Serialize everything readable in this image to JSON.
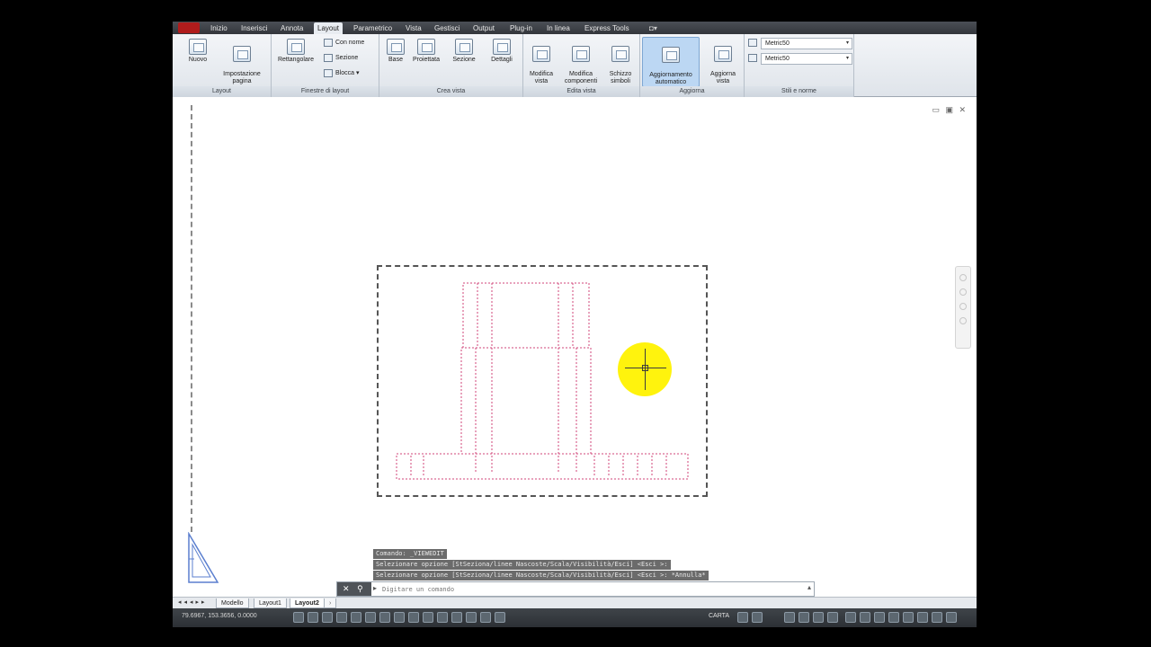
{
  "ribbon": {
    "tabs": [
      "Inizio",
      "Inserisci",
      "Annota",
      "Layout",
      "Parametrico",
      "Vista",
      "Gestisci",
      "Output",
      "Plug-in",
      "In linea",
      "Express Tools"
    ],
    "active_tab": "Layout",
    "panels": {
      "layout": {
        "title": "Layout",
        "buttons": [
          {
            "label": "Nuovo"
          },
          {
            "label": "Impostazione\npagina"
          }
        ]
      },
      "finestre": {
        "title": "Finestre di layout",
        "main_label": "Rettangolare",
        "small": [
          "Con nome",
          "Sezione",
          "Blocca"
        ]
      },
      "crea_vista": {
        "title": "Crea vista",
        "buttons": [
          "Base",
          "Proiettata",
          "Sezione",
          "Dettagli"
        ]
      },
      "edita_vista": {
        "title": "Edita vista",
        "buttons": [
          "Modifica\nvista",
          "Modifica\ncomponenti",
          "Schizzo\nsimboli"
        ]
      },
      "aggiorna": {
        "title": "Aggiorna",
        "buttons": [
          "Aggiornamento\nautomatico",
          "Aggiorna\nvista"
        ],
        "selected": "Aggiornamento\nautomatico"
      },
      "stili": {
        "title": "Stili e norme",
        "dropdowns": [
          "Metric50",
          "Metric50"
        ]
      }
    }
  },
  "command": {
    "history": [
      "Comando:  _VIEWEDIT",
      "Selezionare opzione [StSeziona/linee Nascoste/Scala/Visibilità/Esci] <Esci >:",
      "Selezionare opzione [StSeziona/linee Nascoste/Scala/Visibilità/Esci] <Esci >: *Annulla*"
    ],
    "placeholder": "Digitare un comando",
    "close_glyph": "✕",
    "search_glyph": "⌕",
    "prompt_glyph": "▸"
  },
  "layout_tabs": [
    "Modello",
    "Layout1",
    "Layout2"
  ],
  "layout_tabs_active": "Layout2",
  "status": {
    "coords": "79.6967, 153.3656, 0.0000",
    "paper": "CARTA"
  },
  "icons": {
    "ucs": "ucs-icon",
    "nav": "navigation-bar-icon"
  },
  "colors": {
    "accent": "#bcd7f3",
    "cursor_highlight": "#fff200",
    "hidden_lines": "#d0457a"
  }
}
